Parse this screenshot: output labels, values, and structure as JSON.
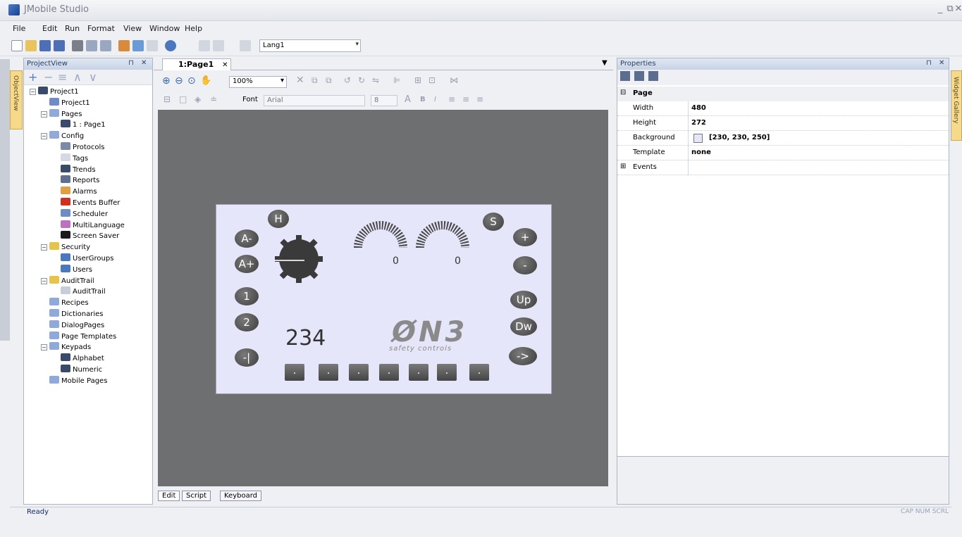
{
  "window": {
    "title": "JMobile Studio",
    "minimize": "_",
    "restore": "⧉",
    "close": "✕"
  },
  "menu": [
    "File",
    "Edit",
    "Run",
    "Format",
    "View",
    "Window",
    "Help"
  ],
  "toolbar": {
    "language": "Lang1"
  },
  "side_tabs": {
    "left": "ObjectView",
    "right": "Widget Gallery"
  },
  "project_view": {
    "title": "ProjectView",
    "pin": "⊓",
    "close": "✕",
    "tools": [
      "+",
      "−",
      "≡",
      "∧",
      "∨"
    ],
    "tree": [
      {
        "label": "Project1",
        "level": 0,
        "exp": "−",
        "color": "#3a4a6b"
      },
      {
        "label": "Project1",
        "level": 1,
        "exp": "",
        "color": "#6f8cc7"
      },
      {
        "label": "Pages",
        "level": 1,
        "exp": "−",
        "color": "#8fa9d8"
      },
      {
        "label": "1 : Page1",
        "level": 2,
        "exp": "",
        "color": "#3a4a6b"
      },
      {
        "label": "Config",
        "level": 1,
        "exp": "−",
        "color": "#8fa9d8"
      },
      {
        "label": "Protocols",
        "level": 2,
        "exp": "",
        "color": "#7c8aa6"
      },
      {
        "label": "Tags",
        "level": 2,
        "exp": "",
        "color": "#d4d9e3"
      },
      {
        "label": "Trends",
        "level": 2,
        "exp": "",
        "color": "#3a4a6b"
      },
      {
        "label": "Reports",
        "level": 2,
        "exp": "",
        "color": "#5f6f8f"
      },
      {
        "label": "Alarms",
        "level": 2,
        "exp": "",
        "color": "#e0a040"
      },
      {
        "label": "Events Buffer",
        "level": 2,
        "exp": "",
        "color": "#d03020"
      },
      {
        "label": "Scheduler",
        "level": 2,
        "exp": "",
        "color": "#6f8cc7"
      },
      {
        "label": "MultiLanguage",
        "level": 2,
        "exp": "",
        "color": "#c070c0"
      },
      {
        "label": "Screen Saver",
        "level": 2,
        "exp": "",
        "color": "#1a1a1a"
      },
      {
        "label": "Security",
        "level": 1,
        "exp": "−",
        "color": "#e6c44a"
      },
      {
        "label": "UserGroups",
        "level": 2,
        "exp": "",
        "color": "#4a78c0"
      },
      {
        "label": "Users",
        "level": 2,
        "exp": "",
        "color": "#4a78c0"
      },
      {
        "label": "AuditTrail",
        "level": 1,
        "exp": "−",
        "color": "#e6c44a"
      },
      {
        "label": "AuditTrail",
        "level": 2,
        "exp": "",
        "color": "#c8cdd8"
      },
      {
        "label": "Recipes",
        "level": 1,
        "exp": "",
        "color": "#8fa9d8"
      },
      {
        "label": "Dictionaries",
        "level": 1,
        "exp": "",
        "color": "#8fa9d8"
      },
      {
        "label": "DialogPages",
        "level": 1,
        "exp": "",
        "color": "#8fa9d8"
      },
      {
        "label": "Page Templates",
        "level": 1,
        "exp": "",
        "color": "#8fa9d8"
      },
      {
        "label": "Keypads",
        "level": 1,
        "exp": "−",
        "color": "#8fa9d8"
      },
      {
        "label": "Alphabet",
        "level": 2,
        "exp": "",
        "color": "#3a4a6b"
      },
      {
        "label": "Numeric",
        "level": 2,
        "exp": "",
        "color": "#3a4a6b"
      },
      {
        "label": "Mobile Pages",
        "level": 1,
        "exp": "",
        "color": "#8fa9d8"
      }
    ]
  },
  "editor": {
    "tab": "1:Page1",
    "tab_close": "✕",
    "zoom": "100%",
    "font_label": "Font",
    "font": "Arial",
    "font_size": "8",
    "bottom_tabs": [
      "Edit",
      "Script",
      "Keyboard"
    ]
  },
  "hmi": {
    "buttons_left": [
      "A-",
      "A+",
      "1",
      "2",
      "-|"
    ],
    "buttons_right": [
      "+",
      "-",
      "Up",
      "Dw",
      "->"
    ],
    "button_h": "H",
    "button_s": "S",
    "gauge_values": [
      "0",
      "0"
    ],
    "numeric_display": "234",
    "logo_text": "ØN3",
    "logo_sub": "safety controls",
    "bottom_buttons": [
      ".",
      ".",
      ".",
      ".",
      ".",
      ".",
      "."
    ]
  },
  "properties": {
    "title": "Properties",
    "pin": "⊓",
    "close": "✕",
    "section": "Page",
    "rows": [
      {
        "name": "Width",
        "value": "480"
      },
      {
        "name": "Height",
        "value": "272"
      },
      {
        "name": "Background",
        "value": "[230, 230, 250]"
      },
      {
        "name": "Template",
        "value": "none"
      }
    ],
    "events": "Events",
    "background_color": "#e6e6fa"
  },
  "status": {
    "text": "Ready",
    "keys": "CAP NUM SCRL"
  }
}
